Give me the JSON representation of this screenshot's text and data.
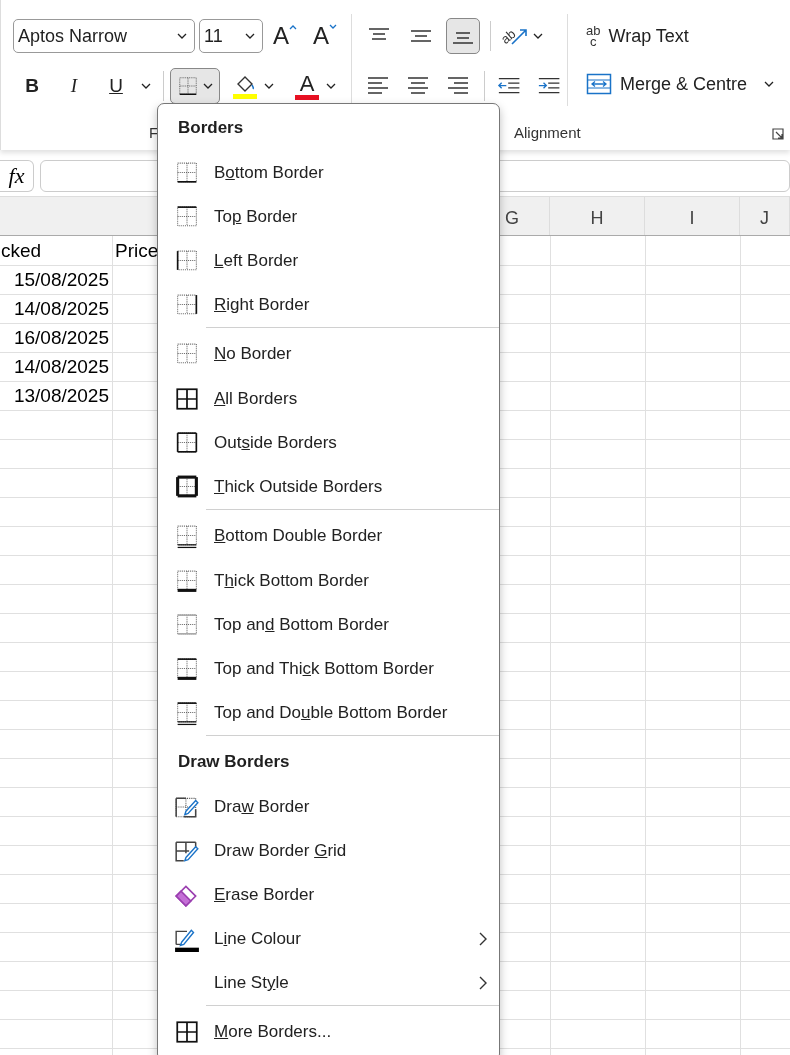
{
  "ribbon": {
    "font_name": "Aptos Narrow",
    "font_size": "11",
    "font_size_buttons": [
      {
        "kind": "grow",
        "glyph": "A"
      },
      {
        "kind": "shrink",
        "glyph": "A"
      }
    ],
    "format_buttons": [
      {
        "kind": "bold",
        "glyph": "B"
      },
      {
        "kind": "italic",
        "glyph": "I"
      },
      {
        "kind": "underline",
        "glyph": "U"
      }
    ],
    "borders_button": {
      "pressed": true
    },
    "font_colour_glyph": "A",
    "vertical_align": [
      {
        "kind": "top",
        "selected": false
      },
      {
        "kind": "middle",
        "selected": false
      },
      {
        "kind": "bottom",
        "selected": true
      }
    ],
    "orientation_letters": "ab",
    "horizontal_align": [
      {
        "kind": "left",
        "selected": false
      },
      {
        "kind": "center",
        "selected": false
      },
      {
        "kind": "right",
        "selected": false
      }
    ],
    "wrap_icon_letters": [
      "ab",
      "c"
    ],
    "wrap_text": "Wrap Text",
    "merge": "Merge & Centre",
    "group_labels": [
      "F",
      "Alignment"
    ]
  },
  "formula_bar": {
    "function_glyph": "fx"
  },
  "sheet": {
    "columns": [
      "G",
      "H",
      "I",
      "J"
    ],
    "rows": [
      [
        "cked",
        "Price"
      ],
      [
        "15/08/2025"
      ],
      [
        "14/08/2025"
      ],
      [
        "16/08/2025"
      ],
      [
        "14/08/2025"
      ],
      [
        "13/08/2025"
      ]
    ]
  },
  "menu": [
    {
      "kind": "header",
      "label": "Borders"
    },
    {
      "kind": "bottom",
      "pre": "B",
      "key": "o",
      "post": "ttom Border",
      "separator_before": false,
      "submenu": false
    },
    {
      "kind": "top",
      "pre": "To",
      "key": "p",
      "post": " Border",
      "separator_before": false,
      "submenu": false
    },
    {
      "kind": "left",
      "key": "L",
      "post": "eft Border",
      "separator_before": false,
      "submenu": false
    },
    {
      "kind": "right",
      "key": "R",
      "post": "ight Border",
      "separator_before": false,
      "submenu": false
    },
    {
      "kind": "none",
      "key": "N",
      "post": "o Border",
      "separator_before": true,
      "submenu": false
    },
    {
      "kind": "all",
      "key": "A",
      "post": "ll Borders",
      "separator_before": false,
      "submenu": false
    },
    {
      "kind": "outside",
      "pre": "Out",
      "key": "s",
      "post": "ide Borders",
      "separator_before": false,
      "submenu": false
    },
    {
      "kind": "thick-outside",
      "key": "T",
      "post": "hick Outside Borders",
      "separator_before": false,
      "submenu": false
    },
    {
      "kind": "bottom-double",
      "key": "B",
      "post": "ottom Double Border",
      "separator_before": true,
      "submenu": false
    },
    {
      "kind": "thick-bottom",
      "pre": "T",
      "key": "h",
      "post": "ick Bottom Border",
      "separator_before": false,
      "submenu": false
    },
    {
      "kind": "top-bottom",
      "pre": "Top an",
      "key": "d",
      "post": " Bottom Border",
      "separator_before": false,
      "submenu": false
    },
    {
      "kind": "top-thick-bottom",
      "pre": "Top and Thi",
      "key": "c",
      "post": "k Bottom Border",
      "separator_before": false,
      "submenu": false
    },
    {
      "kind": "top-double-bottom",
      "pre": "Top and Do",
      "key": "u",
      "post": "ble Bottom Border",
      "separator_before": false,
      "submenu": false
    },
    {
      "kind": "header",
      "label": "Draw Borders",
      "separator_before": true
    },
    {
      "kind": "draw",
      "pre": "Dra",
      "key": "w",
      "post": " Border",
      "separator_before": false,
      "submenu": false
    },
    {
      "kind": "draw-grid",
      "pre": "Draw Border ",
      "key": "G",
      "post": "rid",
      "separator_before": false,
      "submenu": false
    },
    {
      "kind": "erase",
      "key": "E",
      "post": "rase Border",
      "separator_before": false,
      "submenu": false
    },
    {
      "kind": "line-colour",
      "pre": "L",
      "key": "i",
      "post": "ne Colour",
      "separator_before": false,
      "submenu": true
    },
    {
      "kind": "line-style",
      "pre": "Line St",
      "key": "y",
      "post": "le",
      "separator_before": false,
      "submenu": true
    },
    {
      "kind": "all",
      "key": "M",
      "post": "ore Borders...",
      "separator_before": true,
      "submenu": false
    }
  ]
}
